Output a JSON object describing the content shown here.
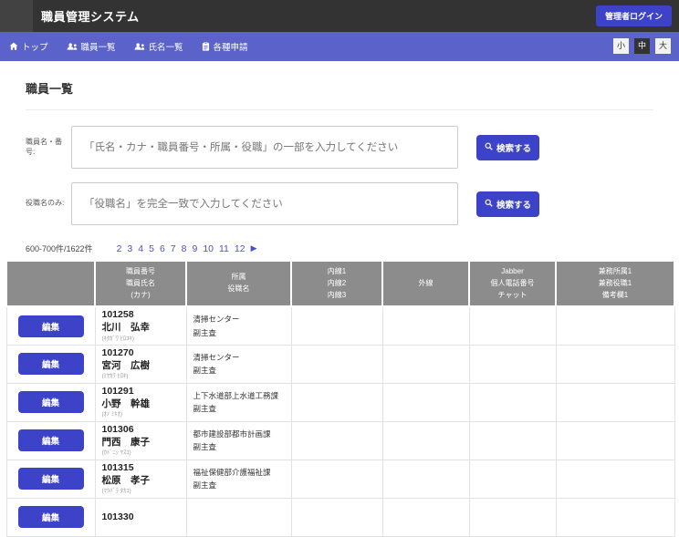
{
  "header": {
    "title": "職員管理システム",
    "login_button": "管理者ログイン"
  },
  "nav": {
    "items": [
      {
        "label": "トップ",
        "icon": "home-icon"
      },
      {
        "label": "職員一覧",
        "icon": "users-icon"
      },
      {
        "label": "氏名一覧",
        "icon": "users-icon"
      },
      {
        "label": "各種申請",
        "icon": "clipboard-icon"
      }
    ],
    "font_size_buttons": [
      {
        "label": "小",
        "active": false
      },
      {
        "label": "中",
        "active": true
      },
      {
        "label": "大",
        "active": false
      }
    ]
  },
  "page": {
    "title": "職員一覧"
  },
  "search": {
    "name_field": {
      "label": "職員名・番号:",
      "value": "",
      "placeholder": "「氏名・カナ・職員番号・所属・役職」の一部を入力してください",
      "button": "検索する"
    },
    "role_field": {
      "label": "役職名のみ:",
      "value": "",
      "placeholder": "「役職名」を完全一致で入力してください",
      "button": "検索する"
    }
  },
  "pagination": {
    "count_text": "600-700件/1622件",
    "pages": [
      "2",
      "3",
      "4",
      "5",
      "6",
      "7",
      "8",
      "9",
      "10",
      "11",
      "12"
    ],
    "next_icon": "▶"
  },
  "table": {
    "edit_button": "編集",
    "headers": [
      {
        "lines": [
          "",
          "",
          ""
        ]
      },
      {
        "lines": [
          "職員番号",
          "職員氏名",
          "(カナ)"
        ]
      },
      {
        "lines": [
          "所属",
          "役職名",
          ""
        ]
      },
      {
        "lines": [
          "内線1",
          "内線2",
          "内線3"
        ]
      },
      {
        "lines": [
          "外線",
          "",
          ""
        ]
      },
      {
        "lines": [
          "Jabber",
          "個人電話番号",
          "チャット"
        ]
      },
      {
        "lines": [
          "兼務所属1",
          "兼務役職1",
          "備考欄1"
        ]
      }
    ],
    "rows": [
      {
        "id": "101258",
        "name": "北川　弘幸",
        "kana": "(ｷﾀｶﾞﾜ ﾋﾛﾕｷ)",
        "dept": "清掃センター",
        "role": "副主査"
      },
      {
        "id": "101270",
        "name": "宮河　広樹",
        "kana": "(ﾐﾔｶﾜ ﾋﾛｷ)",
        "dept": "清掃センター",
        "role": "副主査"
      },
      {
        "id": "101291",
        "name": "小野　幹雄",
        "kana": "(ｵﾉ ﾐｷｵ)",
        "dept": "上下水道部上水道工務課",
        "role": "副主査"
      },
      {
        "id": "101306",
        "name": "門西　康子",
        "kana": "(ｶﾄﾞﾆｼ ﾔｽｺ)",
        "dept": "都市建設部都市計画課",
        "role": "副主査"
      },
      {
        "id": "101315",
        "name": "松原　孝子",
        "kana": "(ﾏﾂﾊﾞﾗ ﾀｶｺ)",
        "dept": "福祉保健部介護福祉課",
        "role": "副主査"
      },
      {
        "id": "101330",
        "name": "",
        "kana": "",
        "dept": "",
        "role": ""
      }
    ]
  },
  "colors": {
    "topbar": "#333333",
    "navbar": "#5b62c9",
    "accent": "#3d43c8",
    "table_header": "#8c8c8c"
  }
}
